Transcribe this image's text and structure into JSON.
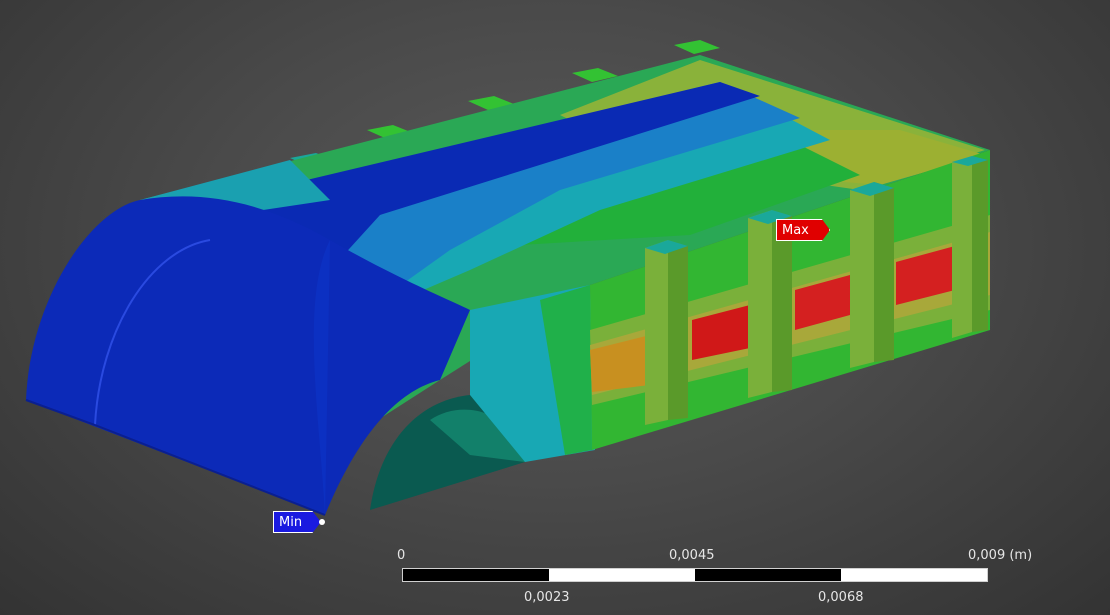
{
  "viewport": {
    "probes": {
      "max_label": "Max",
      "min_label": "Min"
    },
    "colors": {
      "max": "#e00000",
      "min": "#1a1ae0"
    }
  },
  "scale_bar": {
    "top_labels": [
      "0",
      "0,0045",
      "0,009 (m)"
    ],
    "bottom_labels": [
      "0,0023",
      "0,0068"
    ]
  }
}
